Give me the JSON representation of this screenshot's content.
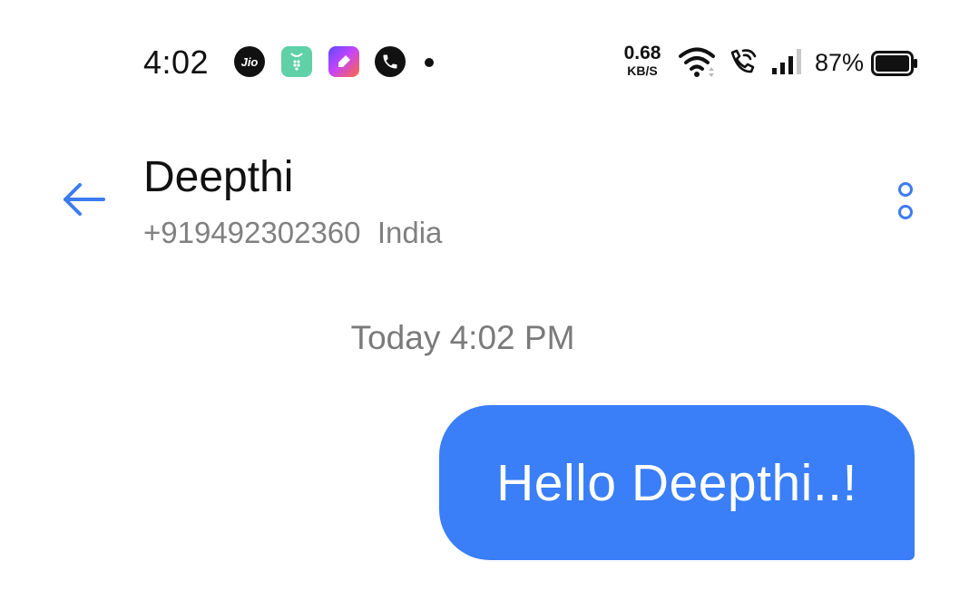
{
  "status_bar": {
    "time": "4:02",
    "carrier_icon_text": "Jio",
    "net_speed_value": "0.68",
    "net_speed_unit": "KB/S",
    "battery_percent": "87%",
    "notification_icons": [
      "jio-icon",
      "app-green-icon",
      "app-gradient-icon",
      "phone-icon",
      "more-dot"
    ],
    "system_icons": [
      "wifi-icon",
      "wifi-call-icon",
      "signal-icon",
      "battery-icon"
    ]
  },
  "header": {
    "back_icon": "arrow-left-icon",
    "contact_name": "Deepthi",
    "contact_number": "+919492302360  India",
    "menu_icon": "more-options-icon"
  },
  "conversation": {
    "timestamp": "Today 4:02 PM",
    "messages": [
      {
        "direction": "outgoing",
        "text": "Hello Deepthi..!"
      }
    ]
  },
  "colors": {
    "accent": "#3d7cf0",
    "bubble": "#3a7ef8",
    "secondary_text": "#808080"
  }
}
